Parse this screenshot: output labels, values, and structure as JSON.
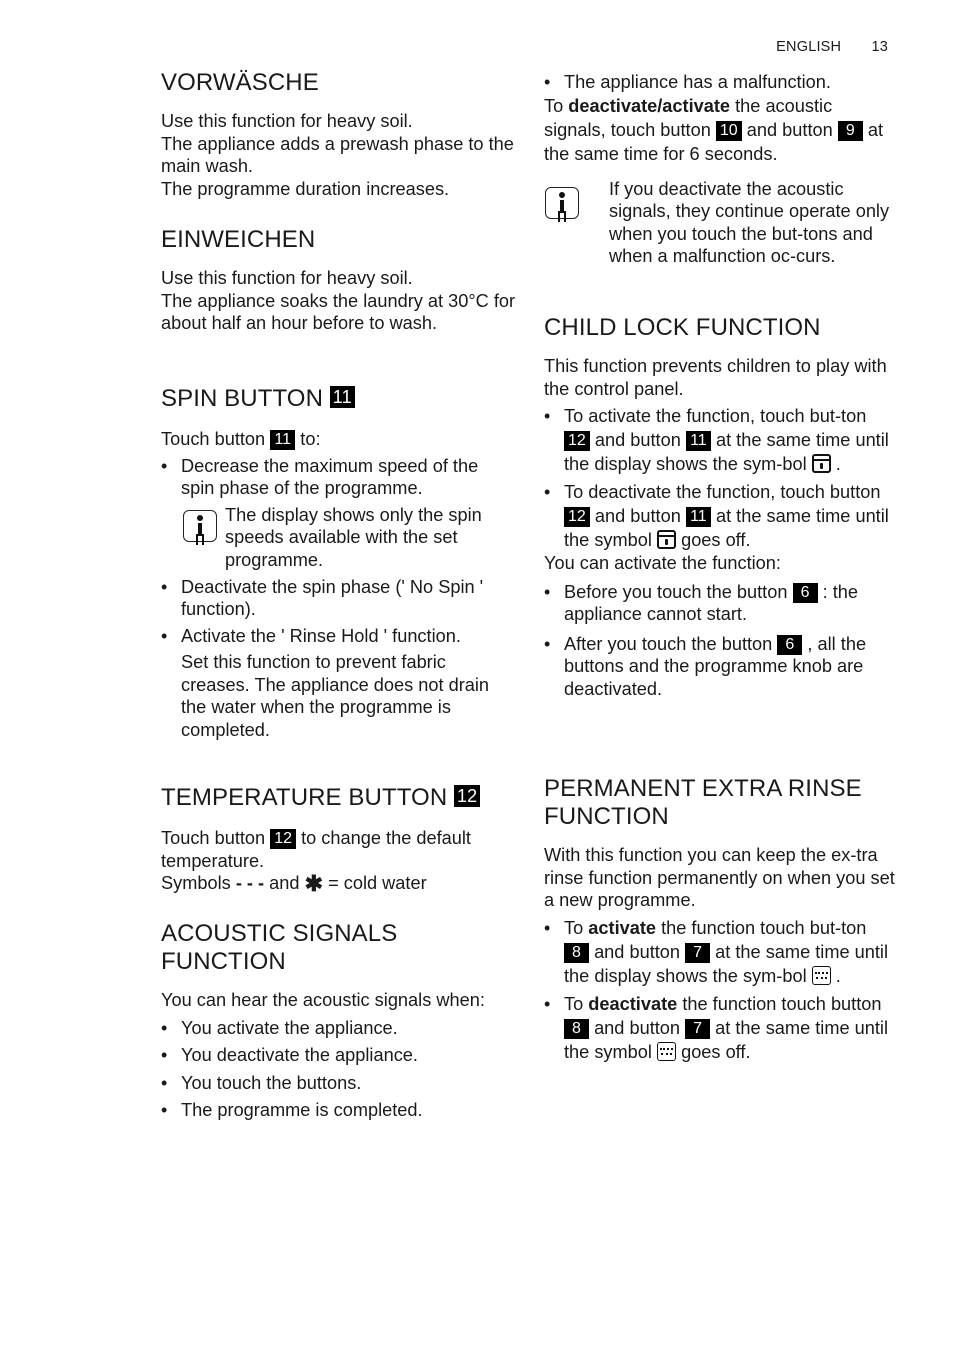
{
  "header": {
    "language": "ENGLISH",
    "page_number": "13"
  },
  "left": {
    "vorwasche": {
      "title": "VORWÄSCHE",
      "lines": [
        "Use this function for heavy soil.",
        "The appliance adds a prewash phase to the main wash.",
        "The programme duration increases."
      ]
    },
    "einweichen": {
      "title": "EINWEICHEN",
      "lines": [
        "Use this function for heavy soil.",
        "The appliance soaks the laundry at 30°C for about half an hour before to wash."
      ]
    },
    "spin": {
      "title": "SPIN BUTTON",
      "button": "11",
      "intro_pre": "Touch button",
      "intro_btn": "11",
      "intro_post": "to:",
      "bullet1": "Decrease the maximum speed of the spin phase of the programme.",
      "info": "The display shows only the spin speeds available with the set programme.",
      "bullet2": "Deactivate the spin phase (' No Spin ' function).",
      "bullet3": "Activate the ' Rinse Hold ' function.",
      "note": "Set this function to prevent fabric creases. The appliance does not drain the water when the programme is completed."
    },
    "temperature": {
      "title": "TEMPERATURE BUTTON",
      "button": "12",
      "line1_pre": "Touch button",
      "line1_btn": "12",
      "line1_post": "to change the default temperature.",
      "line2_pre": "Symbols",
      "line2_dashes": "- - -",
      "line2_mid": "and",
      "line2_symbol": "✱",
      "line2_post": "= cold water"
    },
    "acoustic": {
      "title": "ACOUSTIC SIGNALS FUNCTION",
      "intro": "You can hear the acoustic signals when:",
      "bullets": [
        "You activate the appliance.",
        "You deactivate the appliance.",
        "You touch the buttons.",
        "The programme is completed."
      ]
    }
  },
  "right": {
    "acoustic_cont": {
      "bullet": "The appliance has a malfunction.",
      "l_to": "To",
      "l_bold": "deactivate/activate",
      "l_rest1": "the acoustic signals, touch button",
      "btn_a": "10",
      "l_and": "and button",
      "btn_b": "9",
      "l_rest2": "at the same time for 6 seconds.",
      "info": "If you deactivate the acoustic signals, they continue operate only when you touch the but-tons and when a malfunction oc-curs."
    },
    "child_lock": {
      "title": "CHILD LOCK FUNCTION",
      "intro": "This function prevents children to play with the control panel.",
      "b1_pre": "To activate the function, touch but-ton",
      "b1_btn1": "12",
      "b1_and": "and button",
      "b1_btn2": "11",
      "b1_post": "at the same time until the display shows the sym-bol",
      "b1_end": ".",
      "b2_pre": "To deactivate the function, touch button",
      "b2_btn1": "12",
      "b2_and": "and button",
      "b2_btn2": "11",
      "b2_post": "at the same time until the symbol",
      "b2_end": "goes off.",
      "can_activate": "You can activate the function:",
      "b3_pre": "Before you touch the button",
      "b3_btn": "6",
      "b3_post": ": the appliance cannot start.",
      "b4_pre": "After you touch the button",
      "b4_btn": "6",
      "b4_post": ", all the buttons and the programme knob are deactivated."
    },
    "extra_rinse": {
      "title": "PERMANENT EXTRA RINSE FUNCTION",
      "intro": "With this function you can keep the ex-tra rinse function permanently on when you set a new programme.",
      "b1_to": "To",
      "b1_bold": "activate",
      "b1_pre": "the function touch but-ton",
      "b1_btn1": "8",
      "b1_and": "and button",
      "b1_btn2": "7",
      "b1_post": "at the same time until the display shows the sym-bol",
      "b1_end": ".",
      "b2_to": "To",
      "b2_bold": "deactivate",
      "b2_pre": "the function touch button",
      "b2_btn1": "8",
      "b2_and": "and button",
      "b2_btn2": "7",
      "b2_post": "at the same time until the symbol",
      "b2_end": "goes off."
    }
  },
  "icons": {
    "info": "info-icon",
    "lock": "child-lock-symbol-icon",
    "rinse": "extra-rinse-symbol-icon",
    "cold": "cold-water-asterisk-icon"
  }
}
